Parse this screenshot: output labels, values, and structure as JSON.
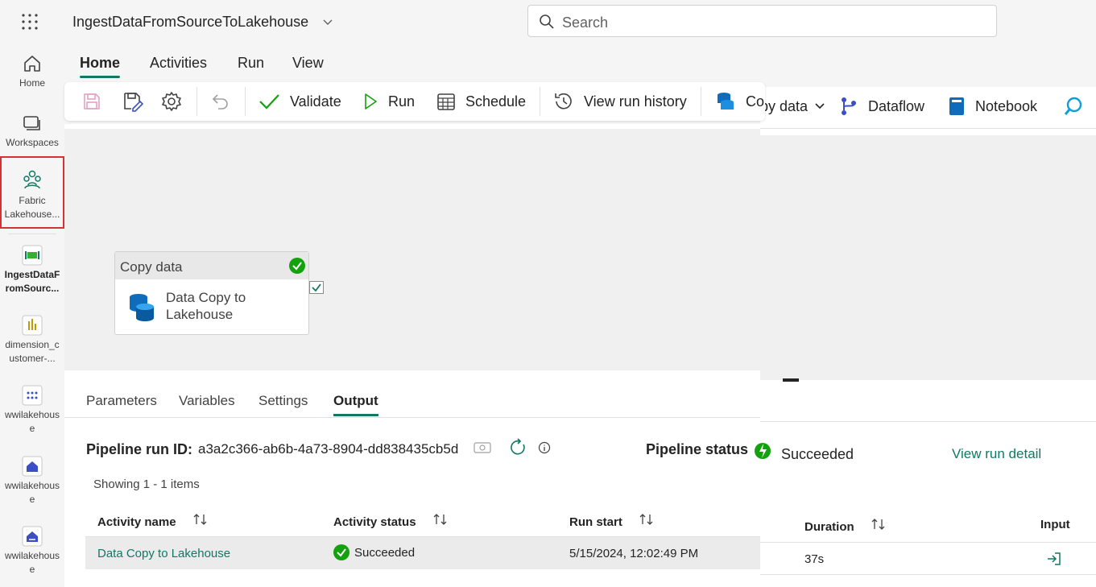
{
  "rail": {
    "home": "Home",
    "workspaces": "Workspaces",
    "fabric_lakehouse": [
      "Fabric",
      "Lakehouse..."
    ],
    "pipeline_item": [
      "IngestDataF",
      "romSourc..."
    ],
    "dimension_item": [
      "dimension_c",
      "ustomer-..."
    ],
    "lake1": [
      "wwilakehous",
      "e"
    ],
    "lake2": [
      "wwilakehous",
      "e"
    ],
    "lake3": [
      "wwilakehous",
      "e"
    ]
  },
  "header": {
    "pipeline_name": "IngestDataFromSourceToLakehouse",
    "search_placeholder": "Search"
  },
  "tabs": [
    "Home",
    "Activities",
    "Run",
    "View"
  ],
  "toolbar": {
    "validate": "Validate",
    "run": "Run",
    "schedule": "Schedule",
    "view_run_history": "View run history",
    "copy_data_cut": "Co",
    "copy_data_right": "py data",
    "dataflow": "Dataflow",
    "notebook": "Notebook"
  },
  "activity": {
    "type": "Copy data",
    "name_line1": "Data Copy to",
    "name_line2": "Lakehouse"
  },
  "output": {
    "tabs": [
      "Parameters",
      "Variables",
      "Settings",
      "Output"
    ],
    "run_id_label": "Pipeline run ID:",
    "run_id": "a3a2c366-ab6b-4a73-8904-dd838435cb5d",
    "status_label": "Pipeline status",
    "status": "Succeeded",
    "view_run_detail": "View run detail",
    "showing": "Showing 1 - 1 items",
    "columns": [
      "Activity name",
      "Activity status",
      "Run start",
      "Duration",
      "Input"
    ],
    "rows": [
      {
        "activity_name": "Data Copy to Lakehouse",
        "activity_status": "Succeeded",
        "run_start": "5/15/2024, 12:02:49 PM",
        "duration": "37s"
      }
    ]
  },
  "colors": {
    "accent": "#117865",
    "success": "#13a10e",
    "highlight_border": "#d13438"
  }
}
